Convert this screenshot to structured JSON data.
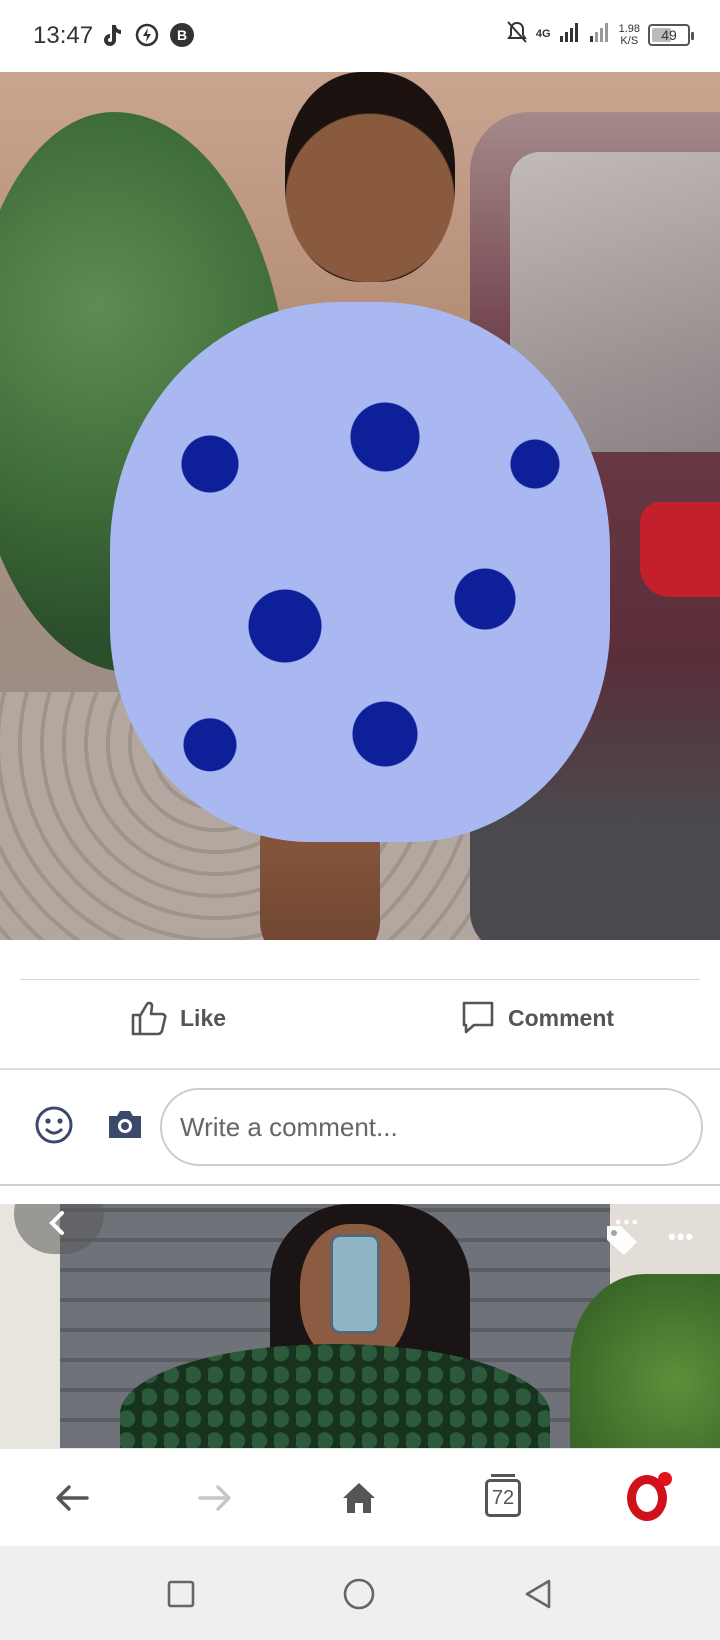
{
  "status_bar": {
    "time": "13:47",
    "left_icons": [
      "tiktok-icon",
      "power-icon",
      "b-icon"
    ],
    "network_type": "4G",
    "speed_value": "1.98",
    "speed_unit": "K/S",
    "battery": "49"
  },
  "post": {
    "image": "photo",
    "actions": {
      "like_label": "Like",
      "comment_label": "Comment"
    }
  },
  "composer": {
    "placeholder": "Write a comment..."
  },
  "next_post": {
    "image": "photo"
  },
  "browser_toolbar": {
    "tab_count": "72"
  },
  "colors": {
    "opera_red": "#d0111b",
    "icon_gray": "#555555",
    "emoji_icon_navy": "#3b4a6b"
  }
}
